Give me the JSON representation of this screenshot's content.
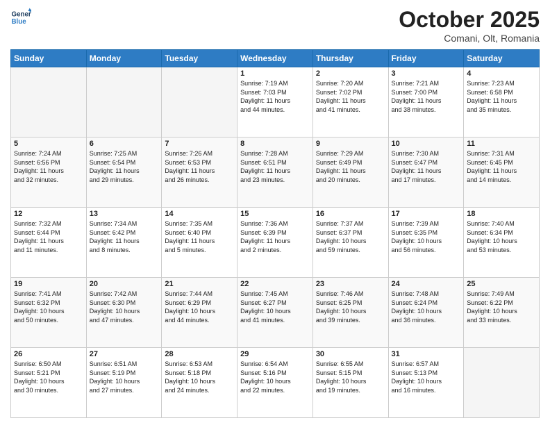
{
  "header": {
    "logo_line1": "General",
    "logo_line2": "Blue",
    "month": "October 2025",
    "location": "Comani, Olt, Romania"
  },
  "weekdays": [
    "Sunday",
    "Monday",
    "Tuesday",
    "Wednesday",
    "Thursday",
    "Friday",
    "Saturday"
  ],
  "weeks": [
    [
      {
        "day": "",
        "info": ""
      },
      {
        "day": "",
        "info": ""
      },
      {
        "day": "",
        "info": ""
      },
      {
        "day": "1",
        "info": "Sunrise: 7:19 AM\nSunset: 7:03 PM\nDaylight: 11 hours\nand 44 minutes."
      },
      {
        "day": "2",
        "info": "Sunrise: 7:20 AM\nSunset: 7:02 PM\nDaylight: 11 hours\nand 41 minutes."
      },
      {
        "day": "3",
        "info": "Sunrise: 7:21 AM\nSunset: 7:00 PM\nDaylight: 11 hours\nand 38 minutes."
      },
      {
        "day": "4",
        "info": "Sunrise: 7:23 AM\nSunset: 6:58 PM\nDaylight: 11 hours\nand 35 minutes."
      }
    ],
    [
      {
        "day": "5",
        "info": "Sunrise: 7:24 AM\nSunset: 6:56 PM\nDaylight: 11 hours\nand 32 minutes."
      },
      {
        "day": "6",
        "info": "Sunrise: 7:25 AM\nSunset: 6:54 PM\nDaylight: 11 hours\nand 29 minutes."
      },
      {
        "day": "7",
        "info": "Sunrise: 7:26 AM\nSunset: 6:53 PM\nDaylight: 11 hours\nand 26 minutes."
      },
      {
        "day": "8",
        "info": "Sunrise: 7:28 AM\nSunset: 6:51 PM\nDaylight: 11 hours\nand 23 minutes."
      },
      {
        "day": "9",
        "info": "Sunrise: 7:29 AM\nSunset: 6:49 PM\nDaylight: 11 hours\nand 20 minutes."
      },
      {
        "day": "10",
        "info": "Sunrise: 7:30 AM\nSunset: 6:47 PM\nDaylight: 11 hours\nand 17 minutes."
      },
      {
        "day": "11",
        "info": "Sunrise: 7:31 AM\nSunset: 6:45 PM\nDaylight: 11 hours\nand 14 minutes."
      }
    ],
    [
      {
        "day": "12",
        "info": "Sunrise: 7:32 AM\nSunset: 6:44 PM\nDaylight: 11 hours\nand 11 minutes."
      },
      {
        "day": "13",
        "info": "Sunrise: 7:34 AM\nSunset: 6:42 PM\nDaylight: 11 hours\nand 8 minutes."
      },
      {
        "day": "14",
        "info": "Sunrise: 7:35 AM\nSunset: 6:40 PM\nDaylight: 11 hours\nand 5 minutes."
      },
      {
        "day": "15",
        "info": "Sunrise: 7:36 AM\nSunset: 6:39 PM\nDaylight: 11 hours\nand 2 minutes."
      },
      {
        "day": "16",
        "info": "Sunrise: 7:37 AM\nSunset: 6:37 PM\nDaylight: 10 hours\nand 59 minutes."
      },
      {
        "day": "17",
        "info": "Sunrise: 7:39 AM\nSunset: 6:35 PM\nDaylight: 10 hours\nand 56 minutes."
      },
      {
        "day": "18",
        "info": "Sunrise: 7:40 AM\nSunset: 6:34 PM\nDaylight: 10 hours\nand 53 minutes."
      }
    ],
    [
      {
        "day": "19",
        "info": "Sunrise: 7:41 AM\nSunset: 6:32 PM\nDaylight: 10 hours\nand 50 minutes."
      },
      {
        "day": "20",
        "info": "Sunrise: 7:42 AM\nSunset: 6:30 PM\nDaylight: 10 hours\nand 47 minutes."
      },
      {
        "day": "21",
        "info": "Sunrise: 7:44 AM\nSunset: 6:29 PM\nDaylight: 10 hours\nand 44 minutes."
      },
      {
        "day": "22",
        "info": "Sunrise: 7:45 AM\nSunset: 6:27 PM\nDaylight: 10 hours\nand 41 minutes."
      },
      {
        "day": "23",
        "info": "Sunrise: 7:46 AM\nSunset: 6:25 PM\nDaylight: 10 hours\nand 39 minutes."
      },
      {
        "day": "24",
        "info": "Sunrise: 7:48 AM\nSunset: 6:24 PM\nDaylight: 10 hours\nand 36 minutes."
      },
      {
        "day": "25",
        "info": "Sunrise: 7:49 AM\nSunset: 6:22 PM\nDaylight: 10 hours\nand 33 minutes."
      }
    ],
    [
      {
        "day": "26",
        "info": "Sunrise: 6:50 AM\nSunset: 5:21 PM\nDaylight: 10 hours\nand 30 minutes."
      },
      {
        "day": "27",
        "info": "Sunrise: 6:51 AM\nSunset: 5:19 PM\nDaylight: 10 hours\nand 27 minutes."
      },
      {
        "day": "28",
        "info": "Sunrise: 6:53 AM\nSunset: 5:18 PM\nDaylight: 10 hours\nand 24 minutes."
      },
      {
        "day": "29",
        "info": "Sunrise: 6:54 AM\nSunset: 5:16 PM\nDaylight: 10 hours\nand 22 minutes."
      },
      {
        "day": "30",
        "info": "Sunrise: 6:55 AM\nSunset: 5:15 PM\nDaylight: 10 hours\nand 19 minutes."
      },
      {
        "day": "31",
        "info": "Sunrise: 6:57 AM\nSunset: 5:13 PM\nDaylight: 10 hours\nand 16 minutes."
      },
      {
        "day": "",
        "info": ""
      }
    ]
  ]
}
